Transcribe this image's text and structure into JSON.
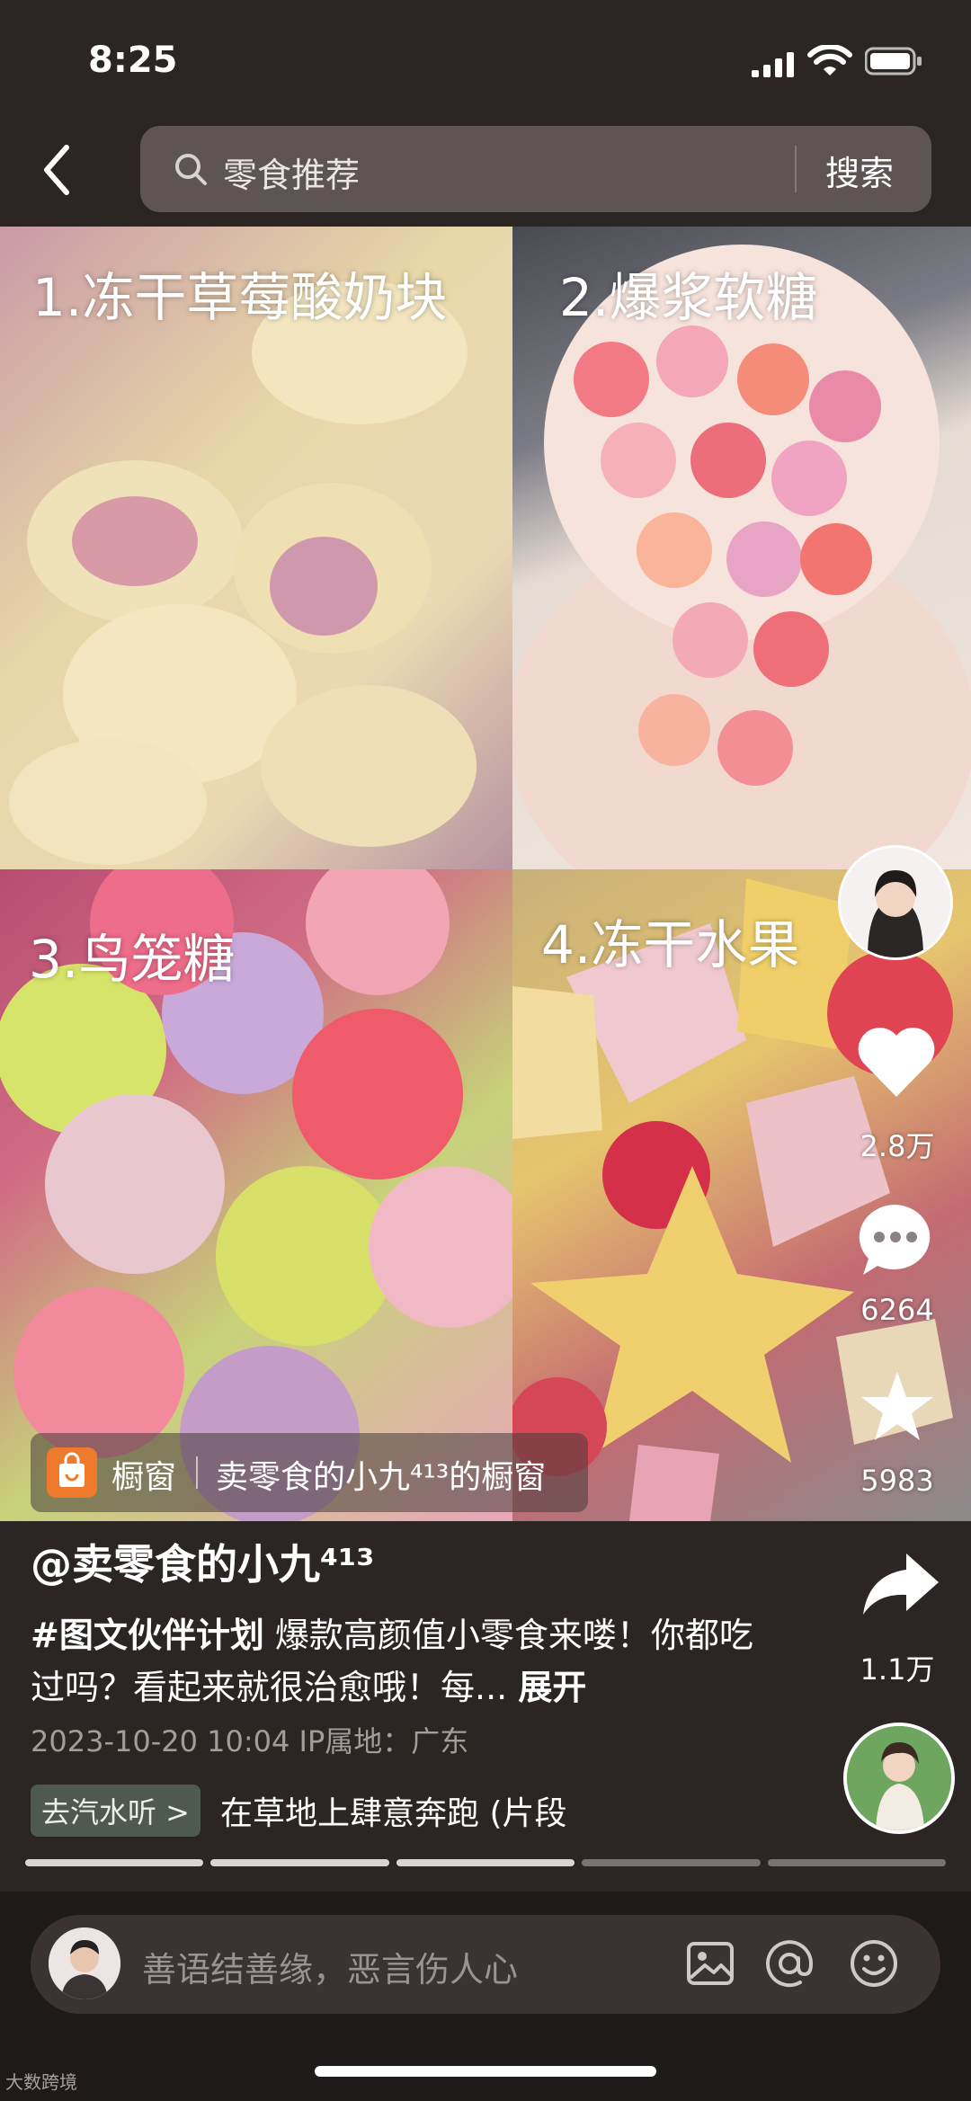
{
  "status_bar": {
    "time": "8:25"
  },
  "search": {
    "query": "零食推荐",
    "button_label": "搜索"
  },
  "tiles": [
    {
      "label": "1.冻干草莓酸奶块"
    },
    {
      "label": "2.爆浆软糖"
    },
    {
      "label": "3.鸟笼糖"
    },
    {
      "label": "4.冻干水果"
    }
  ],
  "shop": {
    "label": "橱窗",
    "name": "卖零食的小九⁴¹³的橱窗"
  },
  "rail": {
    "likes": "2.8万",
    "comments": "6264",
    "favorites": "5983",
    "shares": "1.1万"
  },
  "post": {
    "author": "@卖零食的小九⁴¹³",
    "hashtag": "#图文伙伴计划",
    "text": " 爆款高颜值小零食来喽！你都吃过吗？看起来就很治愈哦！每...",
    "expand": "展开",
    "meta": "2023-10-20 10:04  IP属地：广东"
  },
  "music": {
    "tag": "去汽水听 >",
    "title": "在草地上肆意奔跑 (片段"
  },
  "progress": {
    "total_pages": 5,
    "current_page": 3
  },
  "comment_bar": {
    "placeholder": "善语结善缘，恶言伤人心"
  },
  "watermark": "大数跨境",
  "colors": {
    "background": "#2b2524",
    "accent_shop": "#f07a2b"
  }
}
